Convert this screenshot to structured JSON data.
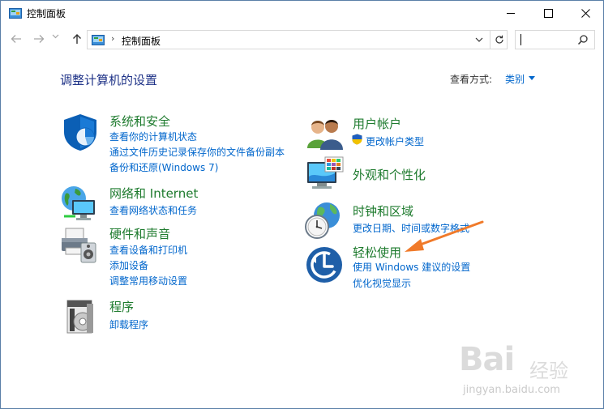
{
  "window": {
    "title": "控制面板"
  },
  "toolbar": {
    "breadcrumb_sep": "›",
    "address_text": "控制面板",
    "search_placeholder": ""
  },
  "header": {
    "page_title": "调整计算机的设置",
    "viewby_label": "查看方式:",
    "viewby_value": "类别"
  },
  "categories": {
    "system": {
      "title": "系统和安全",
      "links": [
        "查看你的计算机状态",
        "通过文件历史记录保存你的文件备份副本",
        "备份和还原(Windows 7)"
      ]
    },
    "network": {
      "title": "网络和 Internet",
      "links": [
        "查看网络状态和任务"
      ]
    },
    "hardware": {
      "title": "硬件和声音",
      "links": [
        "查看设备和打印机",
        "添加设备",
        "调整常用移动设置"
      ]
    },
    "programs": {
      "title": "程序",
      "links": [
        "卸载程序"
      ]
    },
    "users": {
      "title": "用户帐户",
      "links": [
        "更改帐户类型"
      ]
    },
    "appearance": {
      "title": "外观和个性化",
      "links": []
    },
    "clock": {
      "title": "时钟和区域",
      "links": [
        "更改日期、时间或数字格式"
      ]
    },
    "ease": {
      "title": "轻松使用",
      "links": [
        "使用 Windows 建议的设置",
        "优化视觉显示"
      ]
    }
  },
  "watermark": {
    "logo": "Bai",
    "logo_cn": "经验",
    "url": "jingyan.baidu.com"
  },
  "colors": {
    "category_title": "#1e7b2e",
    "link": "#0066cc",
    "heading": "#1e3287",
    "annotation_arrow": "#f07a2a"
  }
}
